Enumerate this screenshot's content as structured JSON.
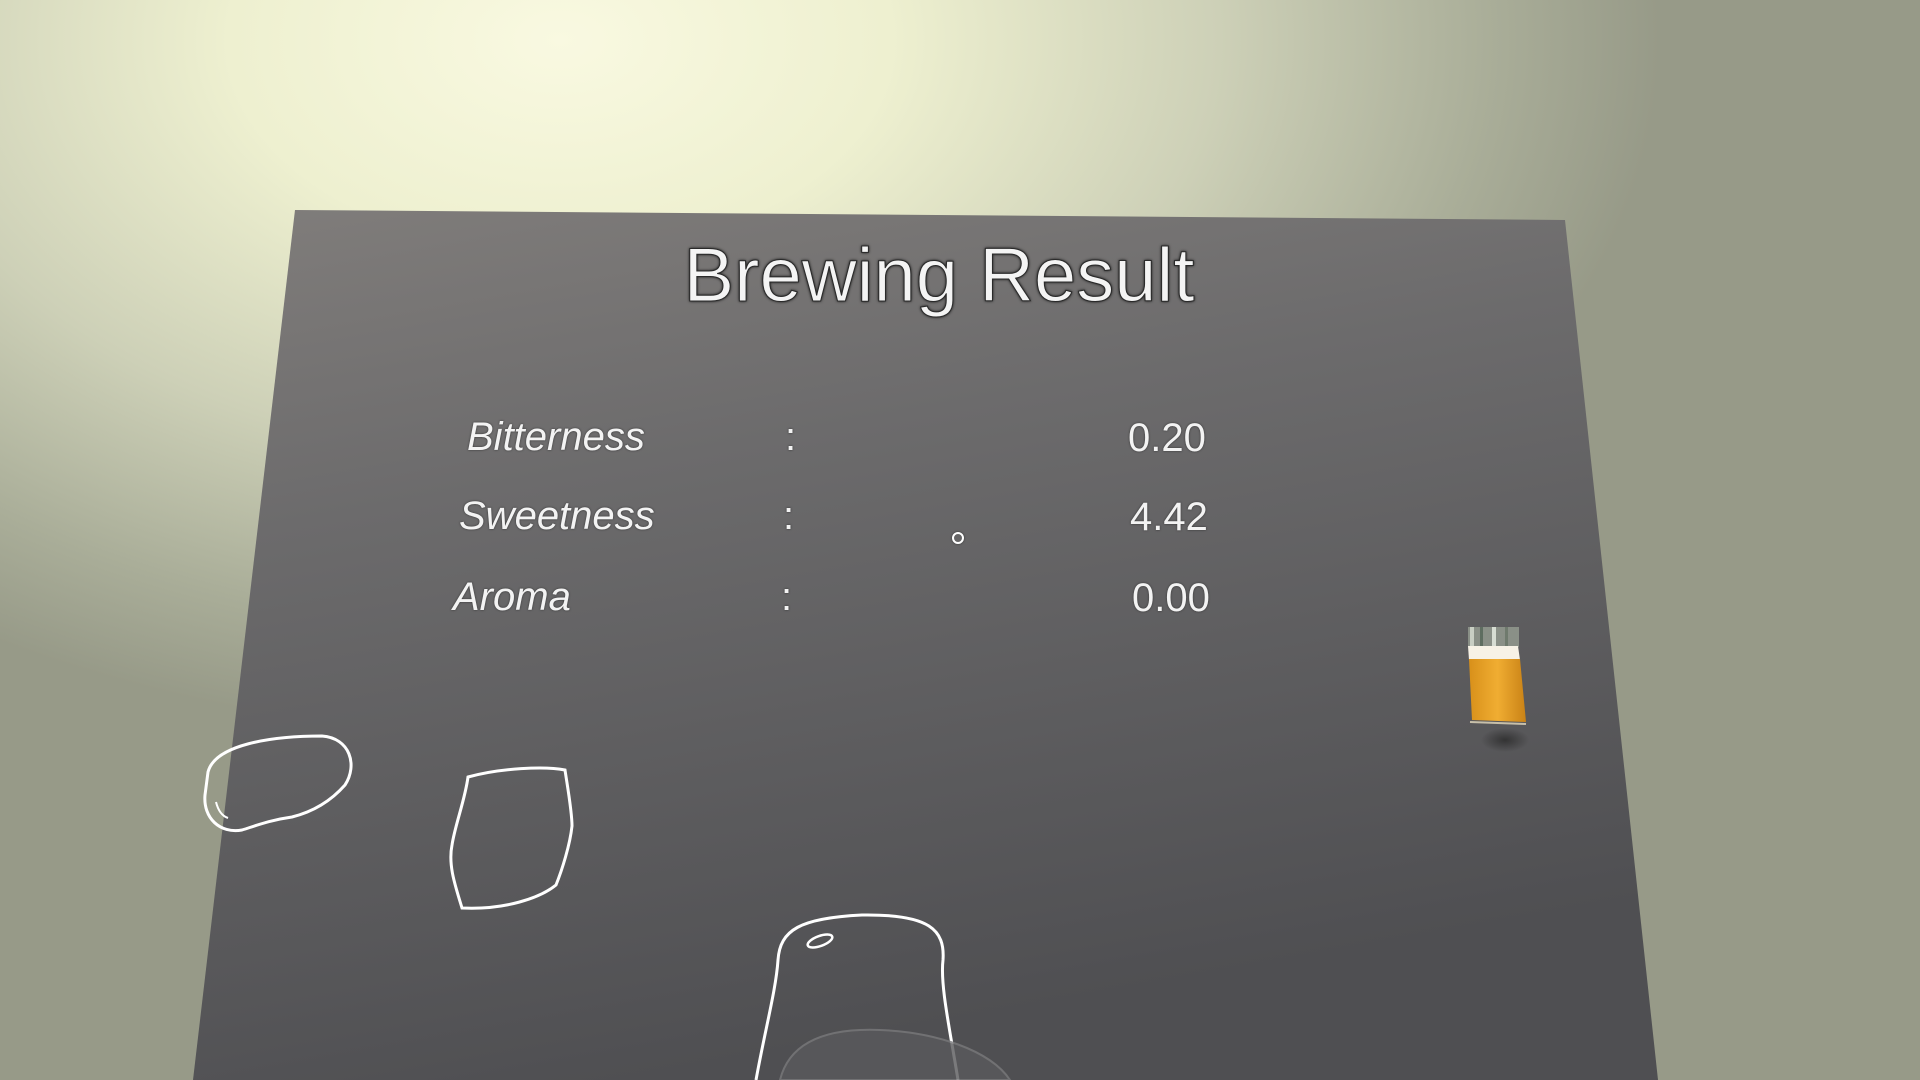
{
  "title": "Brewing Result",
  "stats": [
    {
      "label": "Bitterness",
      "separator": ":",
      "value": "0.20"
    },
    {
      "label": "Sweetness",
      "separator": ":",
      "value": "4.42"
    },
    {
      "label": "Aroma",
      "separator": ":",
      "value": "0.00"
    }
  ],
  "scene_objects": [
    "table-surface",
    "potato-outline",
    "cup-outline",
    "glass-outline",
    "beer-glass-icon"
  ],
  "colors": {
    "table": "#6b6a6a",
    "outline": "#ffffff",
    "beer": "#e4a12a",
    "background": "#f4f5d8"
  }
}
